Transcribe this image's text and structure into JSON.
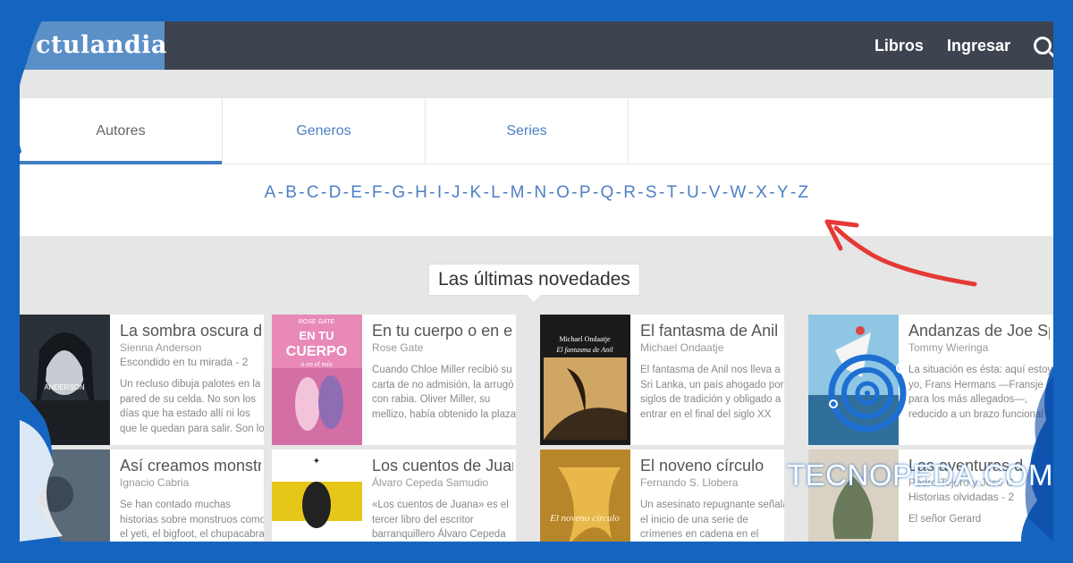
{
  "header": {
    "logo_text": "ctulandia",
    "nav": [
      "Libros",
      "Ingresar"
    ],
    "search_icon": "search-icon"
  },
  "tabs": [
    {
      "label": "Autores",
      "active": true
    },
    {
      "label": "Generos",
      "active": false
    },
    {
      "label": "Series",
      "active": false
    }
  ],
  "letters": [
    "A",
    "B",
    "C",
    "D",
    "E",
    "F",
    "G",
    "H",
    "I",
    "J",
    "K",
    "L",
    "M",
    "N",
    "O",
    "P",
    "Q",
    "R",
    "S",
    "T",
    "U",
    "V",
    "W",
    "X",
    "Y",
    "Z"
  ],
  "section_title": "Las últimas novedades",
  "books": [
    {
      "title": "La sombra oscura de",
      "author": "Sienna Anderson",
      "series": "Escondido en tu mirada - 2",
      "desc": "Un recluso dibuja palotes en la pared de su celda. No son los días que ha estado allí ni los que le quedan para salir. Son los",
      "cover_text": "ANDERSON",
      "cover_color": "#2a3038"
    },
    {
      "title": "En tu cuerpo o en el m",
      "author": "Rose Gate",
      "series": "",
      "desc": "Cuando Chloe Miller recibió su carta de no admisión, la arrugó con rabia. Oliver Miller, su mellizo, había obtenido la plaza",
      "cover_text": "EN TU CUERPO o en el mío",
      "cover_author": "ROSE GATE",
      "cover_color": "#e889b8"
    },
    {
      "title": "El fantasma de Anil",
      "author": "Michael Ondaatje",
      "series": "",
      "desc": "El fantasma de Anil nos lleva a Sri Lanka, un país ahogado por siglos de tradición y obligado a entrar en el final del siglo XX",
      "cover_text": "El fantasma de Anil",
      "cover_author": "Michael Ondaatje",
      "cover_color": "#1c1a18"
    },
    {
      "title": "Andanzas de Joe Sp",
      "author": "Tommy Wieringa",
      "series": "",
      "desc": "La situación es ésta: aquí estoy yo, Frans Hermans —Fransje para los más allegados—, reducido a un brazo funcional",
      "cover_color": "#6fb3d6"
    },
    {
      "title": "Así creamos monstr",
      "author": "Ignacio Cabria",
      "series": "",
      "desc": "Se han contado muchas historias sobre monstruos como el yeti, el bigfoot, el chupacabras",
      "cover_color": "#5a6a78"
    },
    {
      "title": "Los cuentos de Juana",
      "author": "Álvaro Cepeda Samudio",
      "series": "",
      "desc": "«Los cuentos de Juana» es el tercer libro del escritor barranquillero Álvaro Cepeda",
      "cover_color": "#ffffff"
    },
    {
      "title": "El noveno círculo",
      "author": "Fernando S. Llobera",
      "series": "",
      "desc": "Un asesinato repugnante señala el inicio de una serie de crímenes en cadena en el",
      "cover_text": "El noveno círculo",
      "cover_color": "#b8862a"
    },
    {
      "title": "Las aventuras d",
      "author": "Pedro Tejero y José G",
      "series": "Historias olvidadas - 2",
      "desc": "El señor Gerard",
      "cover_color": "#d9d2c4"
    }
  ],
  "watermark": "TECNOPEDA.COM",
  "colors": {
    "accent": "#3f7cc2",
    "link": "#4d7fc4",
    "topbar": "#3d4450",
    "frame": "#1565c0",
    "arrow": "#e53935"
  }
}
